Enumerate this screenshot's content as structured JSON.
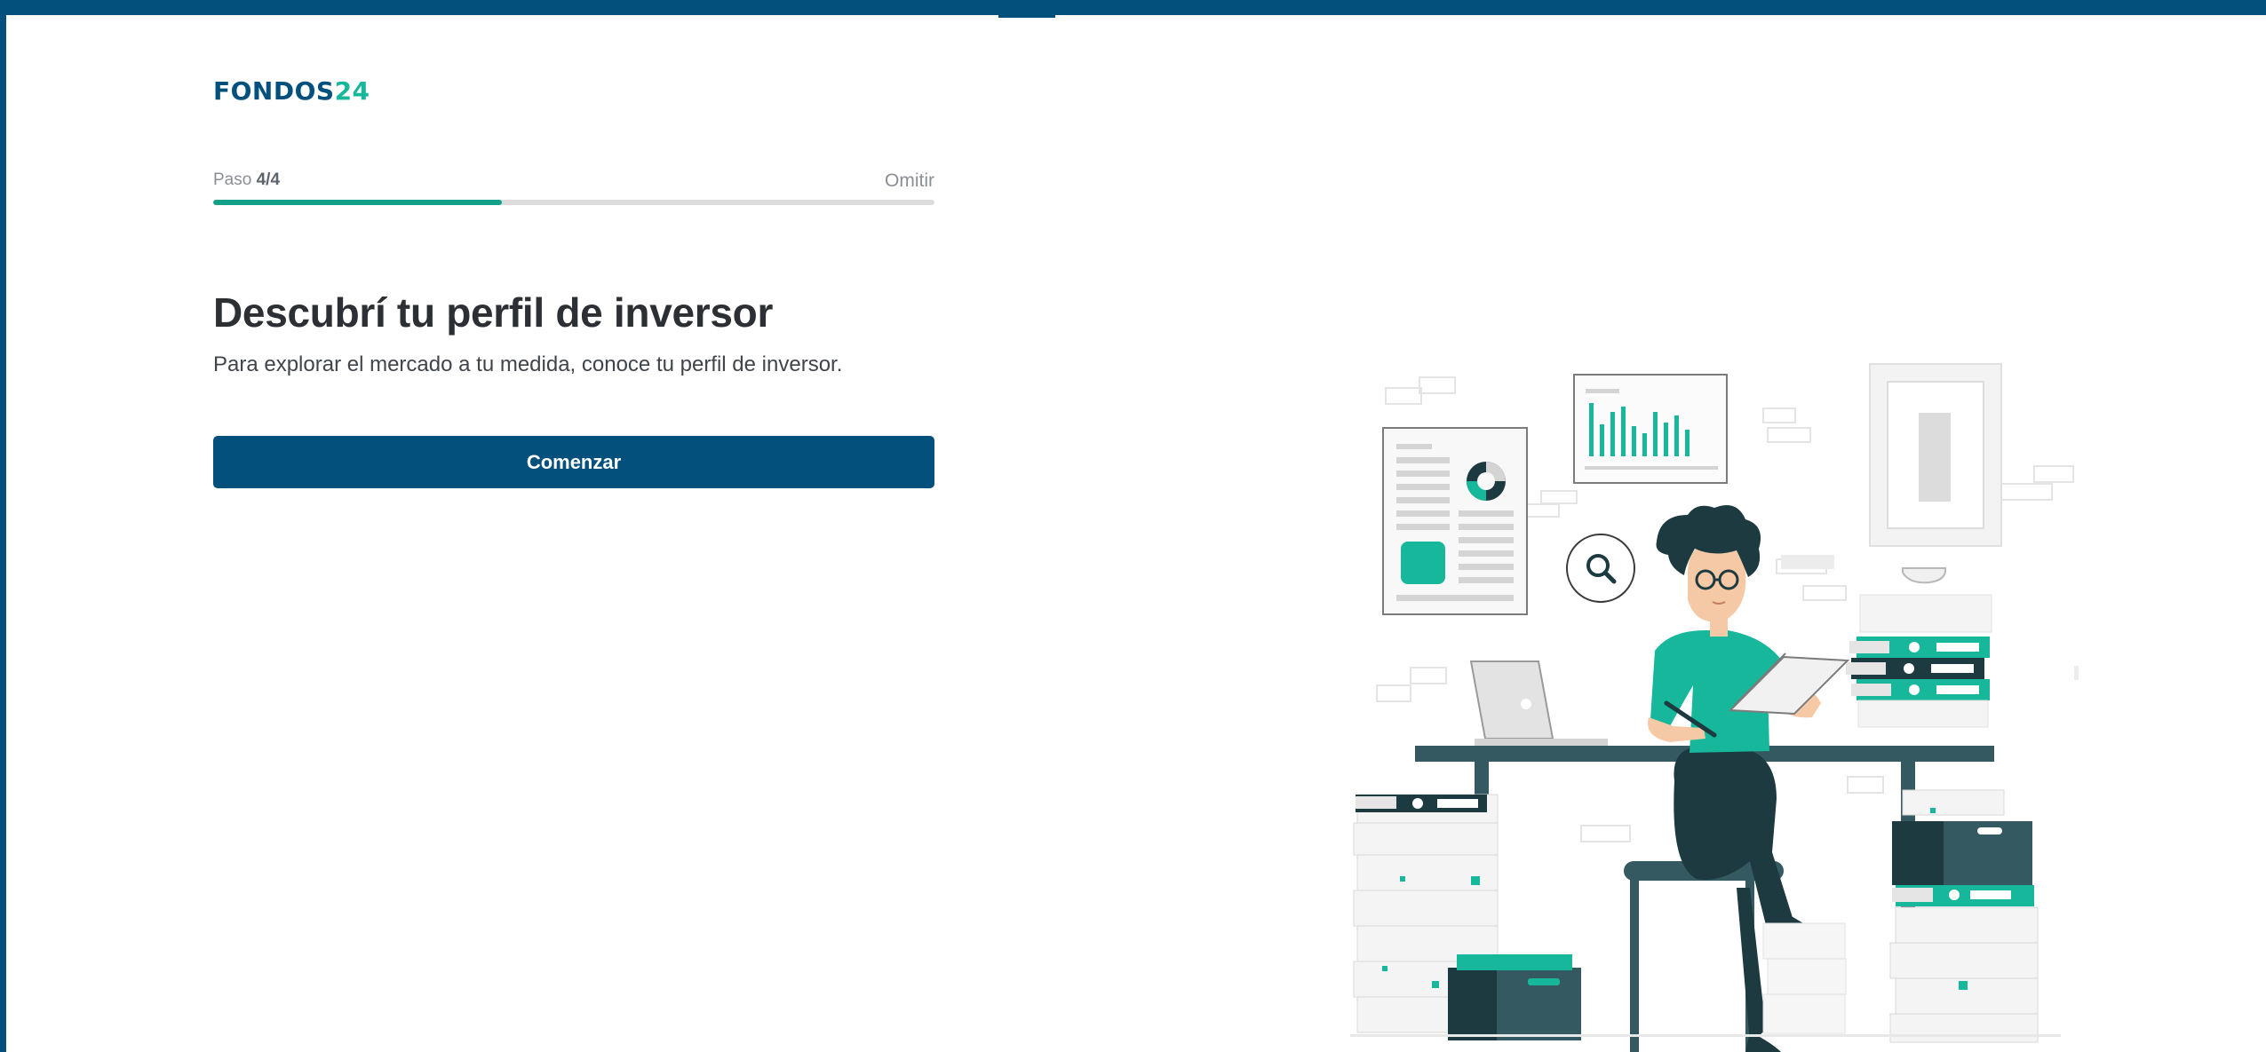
{
  "brand": {
    "logo_primary": "FONDOS",
    "logo_accent": "24",
    "primary_color": "#04507d",
    "accent_color": "#17b79b"
  },
  "progress": {
    "step_prefix": "Paso",
    "step_value": "4/4",
    "skip_label": "Omitir",
    "fill_fraction": 0.4
  },
  "main": {
    "title": "Descubrí tu perfil de inversor",
    "subtitle": "Para explorar el mercado a tu medida, conoce tu perfil de inversor.",
    "cta_label": "Comenzar"
  },
  "illustration": {
    "icon": "investor-at-desk-illustration",
    "teal": "#17b79b",
    "dark": "#1c3a40"
  }
}
